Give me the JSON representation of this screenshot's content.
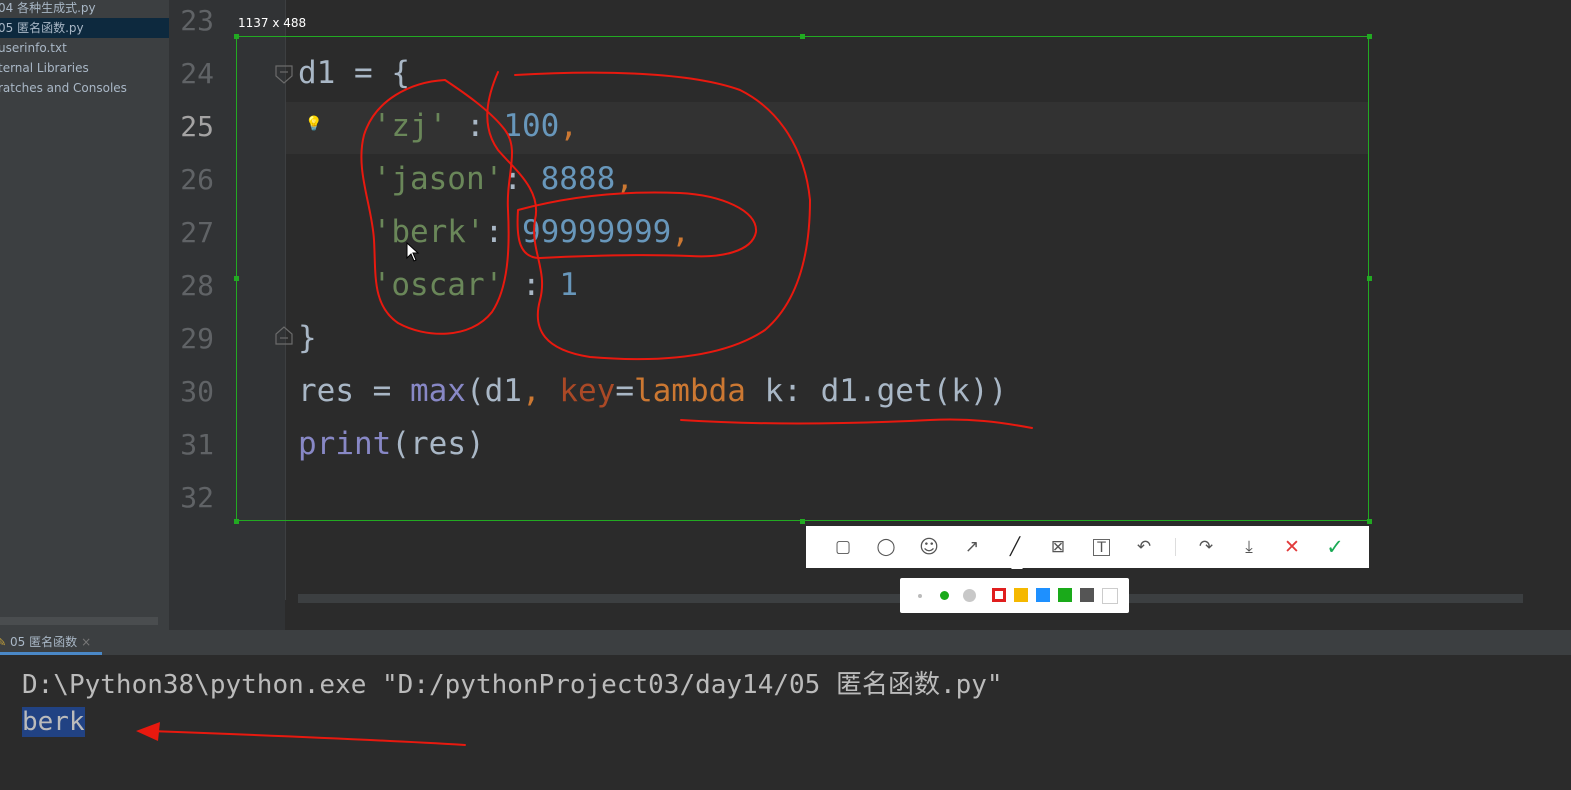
{
  "project_tree": {
    "items": [
      {
        "label": "04 各种生成式.py",
        "selected": false
      },
      {
        "label": "05 匿名函数.py",
        "selected": true
      },
      {
        "label": "userinfo.txt",
        "selected": false
      },
      {
        "label": "ternal Libraries",
        "selected": false
      },
      {
        "label": "ratches and Consoles",
        "selected": false
      }
    ]
  },
  "editor": {
    "line_numbers": [
      "23",
      "24",
      "25",
      "26",
      "27",
      "28",
      "29",
      "30",
      "31",
      "32"
    ],
    "current_line": "25",
    "code": {
      "l24_var": "d1",
      "l24_op": " = {",
      "l25_key": "'zj'",
      "l25_sep": " : ",
      "l25_val": "100",
      "l25_comma": ",",
      "l26_key": "'jason'",
      "l26_sep": ": ",
      "l26_val": "8888",
      "l26_comma": ",",
      "l27_key": "'berk'",
      "l27_sep": ": ",
      "l27_val": "99999999",
      "l27_comma": ",",
      "l28_key": "'oscar'",
      "l28_sep": " : ",
      "l28_val": "1",
      "l29_close": "}",
      "l30_res": "res = ",
      "l30_max": "max",
      "l30_open": "(d1",
      "l30_comma": ", ",
      "l30_key": "key",
      "l30_eq": "=",
      "l30_lambda": "lambda",
      "l30_rest": " k: d1.get(k))",
      "l31_print": "print",
      "l31_rest": "(res)"
    }
  },
  "screenshot_tool": {
    "dimension_label": "1137 x 488",
    "tools": [
      {
        "name": "rectangle-tool-icon",
        "glyph": "▢"
      },
      {
        "name": "ellipse-tool-icon",
        "glyph": "◯"
      },
      {
        "name": "emoji-tool-icon",
        "glyph": "☺"
      },
      {
        "name": "arrow-tool-icon",
        "glyph": "↗"
      },
      {
        "name": "pen-tool-icon",
        "glyph": "╱"
      },
      {
        "name": "mosaic-tool-icon",
        "glyph": "⊠"
      },
      {
        "name": "text-tool-icon",
        "glyph": "T"
      },
      {
        "name": "undo-icon",
        "glyph": "↶"
      },
      {
        "name": "share-icon",
        "glyph": "↷"
      },
      {
        "name": "download-icon",
        "glyph": "⤓"
      },
      {
        "name": "cancel-icon",
        "glyph": "✕"
      },
      {
        "name": "confirm-icon",
        "glyph": "✓"
      }
    ],
    "palette": {
      "sizes": [
        "small",
        "medium",
        "large"
      ],
      "colors": [
        "#e01e1e",
        "#f5b800",
        "#1e90ff",
        "#1aaa1a",
        "#555555",
        "#ffffff"
      ],
      "selected_color": "#e01e1e"
    }
  },
  "console": {
    "tab_label": "05 匿名函数",
    "tab_close": "×",
    "command": "D:\\Python38\\python.exe \"D:/pythonProject03/day14/05 匿名函数.py\"",
    "output": "berk"
  },
  "colors": {
    "annotation_red": "#e8190f",
    "selection_green": "#22aa22"
  }
}
